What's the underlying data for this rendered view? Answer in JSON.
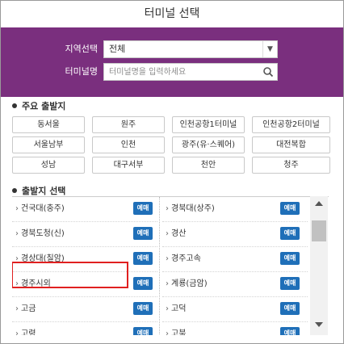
{
  "title": "터미널 선택",
  "search": {
    "region_label": "지역선택",
    "region_value": "전체",
    "terminal_label": "터미널명",
    "terminal_placeholder": "터미널명을 입력하세요"
  },
  "major": {
    "heading": "주요 출발지",
    "items": [
      "동서울",
      "원주",
      "인천공항1터미널",
      "인천공항2터미널",
      "서울남부",
      "인천",
      "광주(유·스퀘어)",
      "대전복합",
      "성남",
      "대구서부",
      "천안",
      "청주"
    ]
  },
  "departure": {
    "heading": "출발지 선택",
    "button_label": "예매",
    "left_items": [
      "건국대(충주)",
      "경북도청(신)",
      "경상대(칠암)",
      "경주시외",
      "고금",
      "고령"
    ],
    "right_items": [
      "경북대(상주)",
      "경산",
      "경주고속",
      "계룡(금암)",
      "고덕",
      "고북"
    ]
  },
  "colors": {
    "header_purple": "#7a2f7e",
    "button_blue": "#1f6fb8",
    "highlight_red": "#e02020"
  }
}
